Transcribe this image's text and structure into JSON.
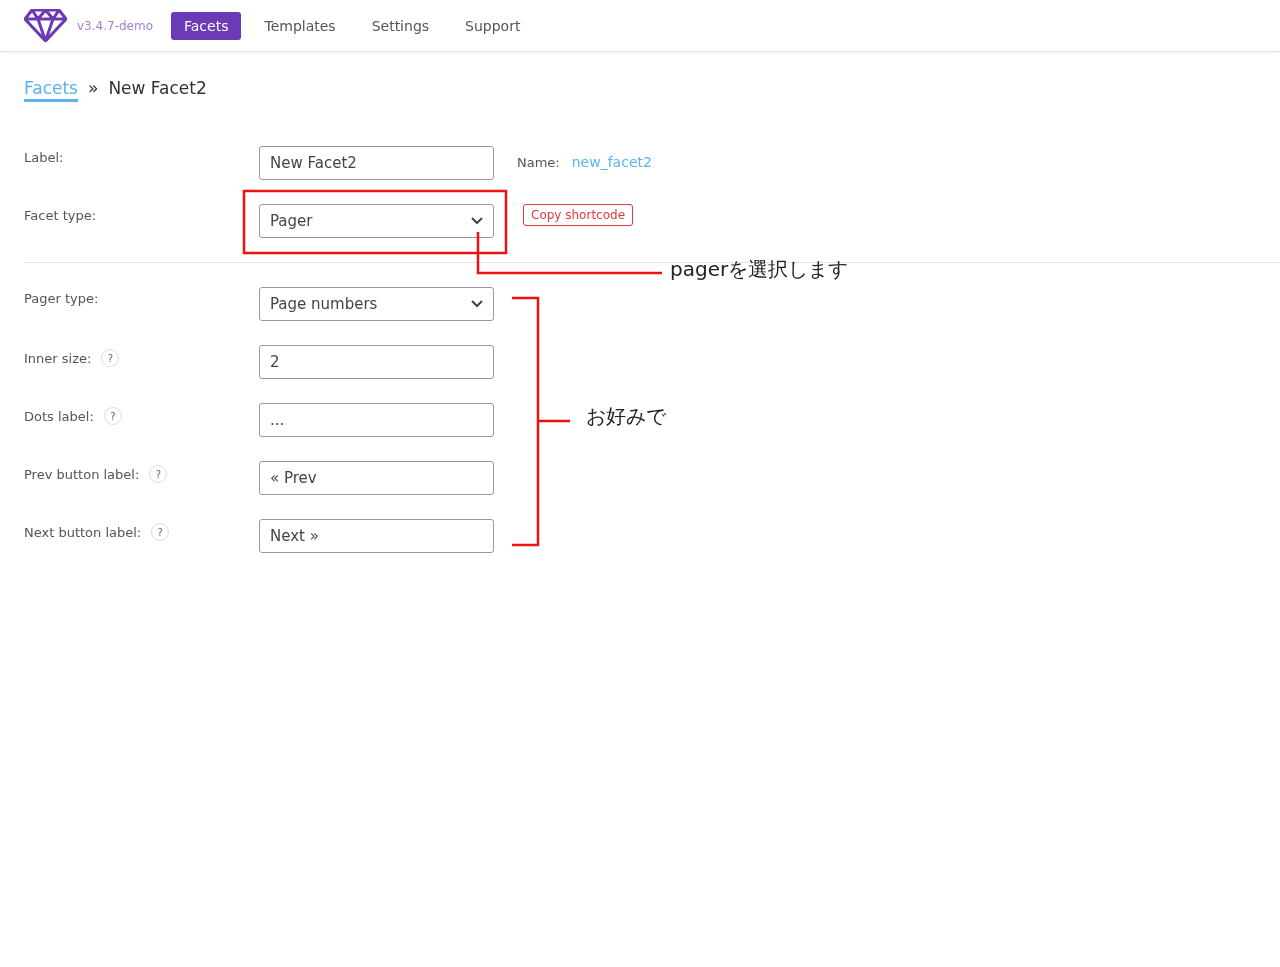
{
  "header": {
    "version": "v3.4.7-demo",
    "nav": [
      {
        "label": "Facets",
        "selected": true
      },
      {
        "label": "Templates",
        "selected": false
      },
      {
        "label": "Settings",
        "selected": false
      },
      {
        "label": "Support",
        "selected": false
      }
    ]
  },
  "breadcrumb": {
    "parent": "Facets",
    "separator": "»",
    "current": "New Facet2"
  },
  "fields": [
    {
      "kind": "text",
      "label": "Label:",
      "value": "New Facet2",
      "name_label": "Name:",
      "name_value": "new_facet2"
    },
    {
      "kind": "select",
      "label": "Facet type:",
      "value": "Pager",
      "action": "Copy shortcode"
    },
    {
      "kind": "divider"
    },
    {
      "kind": "select",
      "label": "Pager type:",
      "value": "Page numbers"
    },
    {
      "kind": "text",
      "label": "Inner size:",
      "help": "?",
      "value": "2"
    },
    {
      "kind": "text",
      "label": "Dots label:",
      "help": "?",
      "value": "..."
    },
    {
      "kind": "text",
      "label": "Prev button label:",
      "help": "?",
      "value": "« Prev"
    },
    {
      "kind": "text",
      "label": "Next button label:",
      "help": "?",
      "value": "Next »"
    }
  ],
  "annotations": [
    {
      "kind": "callout",
      "text": "pagerを選択します"
    },
    {
      "kind": "bracket",
      "text": "お好みで"
    }
  ]
}
